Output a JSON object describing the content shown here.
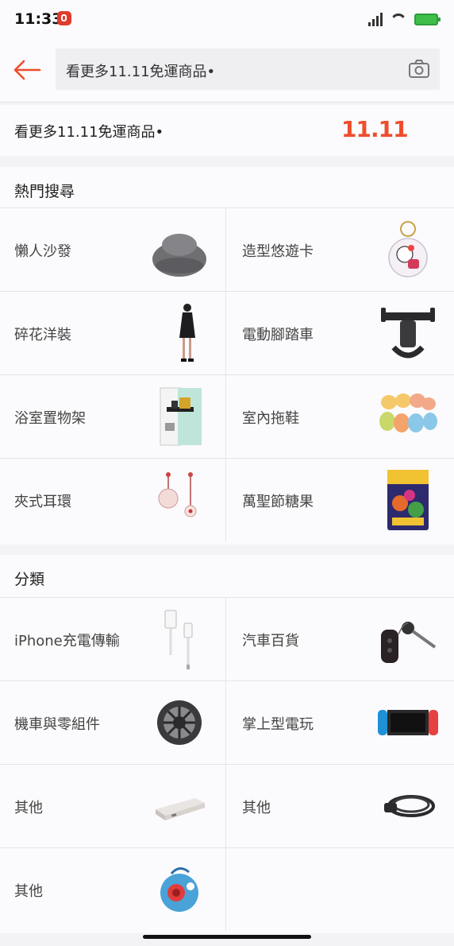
{
  "status_bar": {
    "time": "11:33",
    "battery_text": ""
  },
  "search": {
    "query": "看更多11.11免運商品•"
  },
  "promo": {
    "text": "看更多11.11免運商品•",
    "badge": "11.11"
  },
  "hot_search": {
    "title": "熱門搜尋",
    "items": [
      {
        "label": "懶人沙發",
        "icon": "bean-bag-sofa"
      },
      {
        "label": "造型悠遊卡",
        "icon": "character-card-keychain"
      },
      {
        "label": "碎花洋裝",
        "icon": "dress"
      },
      {
        "label": "電動腳踏車",
        "icon": "bike-phone-holder"
      },
      {
        "label": "浴室置物架",
        "icon": "bathroom-shelf"
      },
      {
        "label": "室內拖鞋",
        "icon": "slippers"
      },
      {
        "label": "夾式耳環",
        "icon": "clip-earrings"
      },
      {
        "label": "萬聖節糖果",
        "icon": "candy-pack"
      }
    ]
  },
  "categories": {
    "title": "分類",
    "items": [
      {
        "label": "iPhone充電傳輸",
        "icon": "lightning-cable"
      },
      {
        "label": "汽車百貨",
        "icon": "car-key"
      },
      {
        "label": "機車與零組件",
        "icon": "motorcycle-wheel"
      },
      {
        "label": "掌上型電玩",
        "icon": "handheld-console"
      },
      {
        "label": "其他",
        "icon": "power-bank"
      },
      {
        "label": "其他",
        "icon": "cable-lock"
      },
      {
        "label": "其他",
        "icon": "toy-figure"
      }
    ]
  },
  "colors": {
    "accent": "#ee4d2d",
    "background": "#f3f2f4",
    "surface": "#fbfafc"
  }
}
